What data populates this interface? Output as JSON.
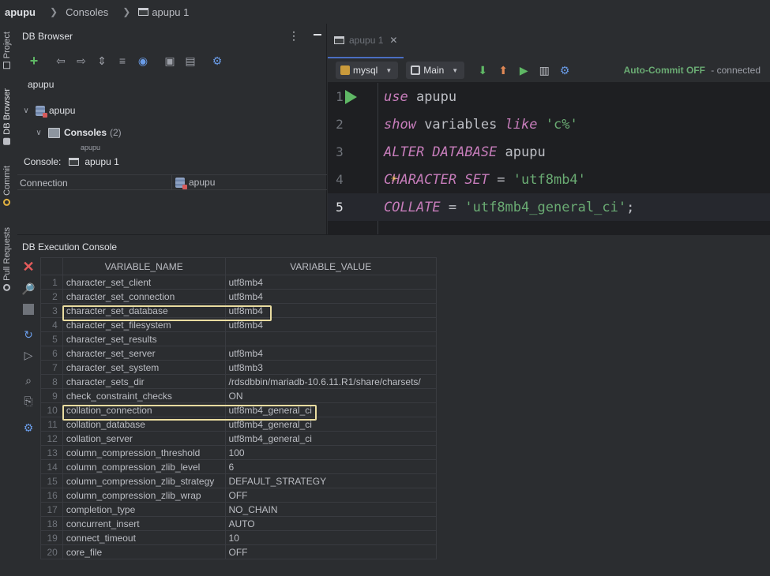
{
  "breadcrumb": {
    "project": "apupu",
    "consoles": "Consoles",
    "console": "apupu 1"
  },
  "toolstrip": {
    "project": "Project",
    "db_browser": "DB Browser",
    "commit": "Commit",
    "pull_requests": "Pull Requests"
  },
  "db_browser": {
    "title": "DB Browser",
    "root_label": "apupu",
    "tree": {
      "connection": "apupu",
      "consoles_label": "Consoles",
      "consoles_count": "(2)",
      "partial_child": "apupu"
    },
    "console_label": "Console:",
    "console_value": "apupu 1",
    "connection_label": "Connection",
    "connection_value": "apupu"
  },
  "editor": {
    "tab_label": "apupu 1",
    "schema_select": "mysql",
    "session_select": "Main",
    "autocommit": "Auto-Commit OFF",
    "status": "- connected",
    "lines": [
      {
        "num": "1",
        "tokens": [
          {
            "t": "use",
            "c": "kw"
          },
          {
            "t": " apupu",
            "c": "id"
          }
        ]
      },
      {
        "num": "2",
        "tokens": [
          {
            "t": "show",
            "c": "kw"
          },
          {
            "t": " variables ",
            "c": "id"
          },
          {
            "t": "like",
            "c": "kw"
          },
          {
            "t": " ",
            "c": "id"
          },
          {
            "t": "'c%'",
            "c": "str"
          }
        ]
      },
      {
        "num": "3",
        "tokens": [
          {
            "t": "ALTER DATABASE",
            "c": "kw"
          },
          {
            "t": " apupu",
            "c": "id"
          }
        ]
      },
      {
        "num": "4",
        "tokens": [
          {
            "t": "CHARACTER SET",
            "c": "kw"
          },
          {
            "t": " = ",
            "c": "id"
          },
          {
            "t": "'utf8mb4'",
            "c": "str"
          }
        ]
      },
      {
        "num": "5",
        "tokens": [
          {
            "t": "COLLATE",
            "c": "kw"
          },
          {
            "t": " = ",
            "c": "id"
          },
          {
            "t": "'utf8mb4_general_ci'",
            "c": "str"
          },
          {
            "t": ";",
            "c": "id"
          }
        ]
      }
    ]
  },
  "exec_console": {
    "title": "DB Execution Console",
    "columns": [
      "VARIABLE_NAME",
      "VARIABLE_VALUE"
    ],
    "rows": [
      [
        "1",
        "character_set_client",
        "utf8mb4"
      ],
      [
        "2",
        "character_set_connection",
        "utf8mb4"
      ],
      [
        "3",
        "character_set_database",
        "utf8mb4"
      ],
      [
        "4",
        "character_set_filesystem",
        "utf8mb4"
      ],
      [
        "5",
        "character_set_results",
        ""
      ],
      [
        "6",
        "character_set_server",
        "utf8mb4"
      ],
      [
        "7",
        "character_set_system",
        "utf8mb3"
      ],
      [
        "8",
        "character_sets_dir",
        "/rdsdbbin/mariadb-10.6.11.R1/share/charsets/"
      ],
      [
        "9",
        "check_constraint_checks",
        "ON"
      ],
      [
        "10",
        "collation_connection",
        "utf8mb4_general_ci"
      ],
      [
        "11",
        "collation_database",
        "utf8mb4_general_ci"
      ],
      [
        "12",
        "collation_server",
        "utf8mb4_general_ci"
      ],
      [
        "13",
        "column_compression_threshold",
        "100"
      ],
      [
        "14",
        "column_compression_zlib_level",
        "6"
      ],
      [
        "15",
        "column_compression_zlib_strategy",
        "DEFAULT_STRATEGY"
      ],
      [
        "16",
        "column_compression_zlib_wrap",
        "OFF"
      ],
      [
        "17",
        "completion_type",
        "NO_CHAIN"
      ],
      [
        "18",
        "concurrent_insert",
        "AUTO"
      ],
      [
        "19",
        "connect_timeout",
        "10"
      ],
      [
        "20",
        "core_file",
        "OFF"
      ]
    ],
    "highlighted_rows": [
      3,
      10
    ]
  },
  "colors": {
    "keyword": "#c77dbb",
    "string": "#6aab73",
    "highlight_box": "#e9dca0",
    "autocommit": "#6aab73"
  }
}
